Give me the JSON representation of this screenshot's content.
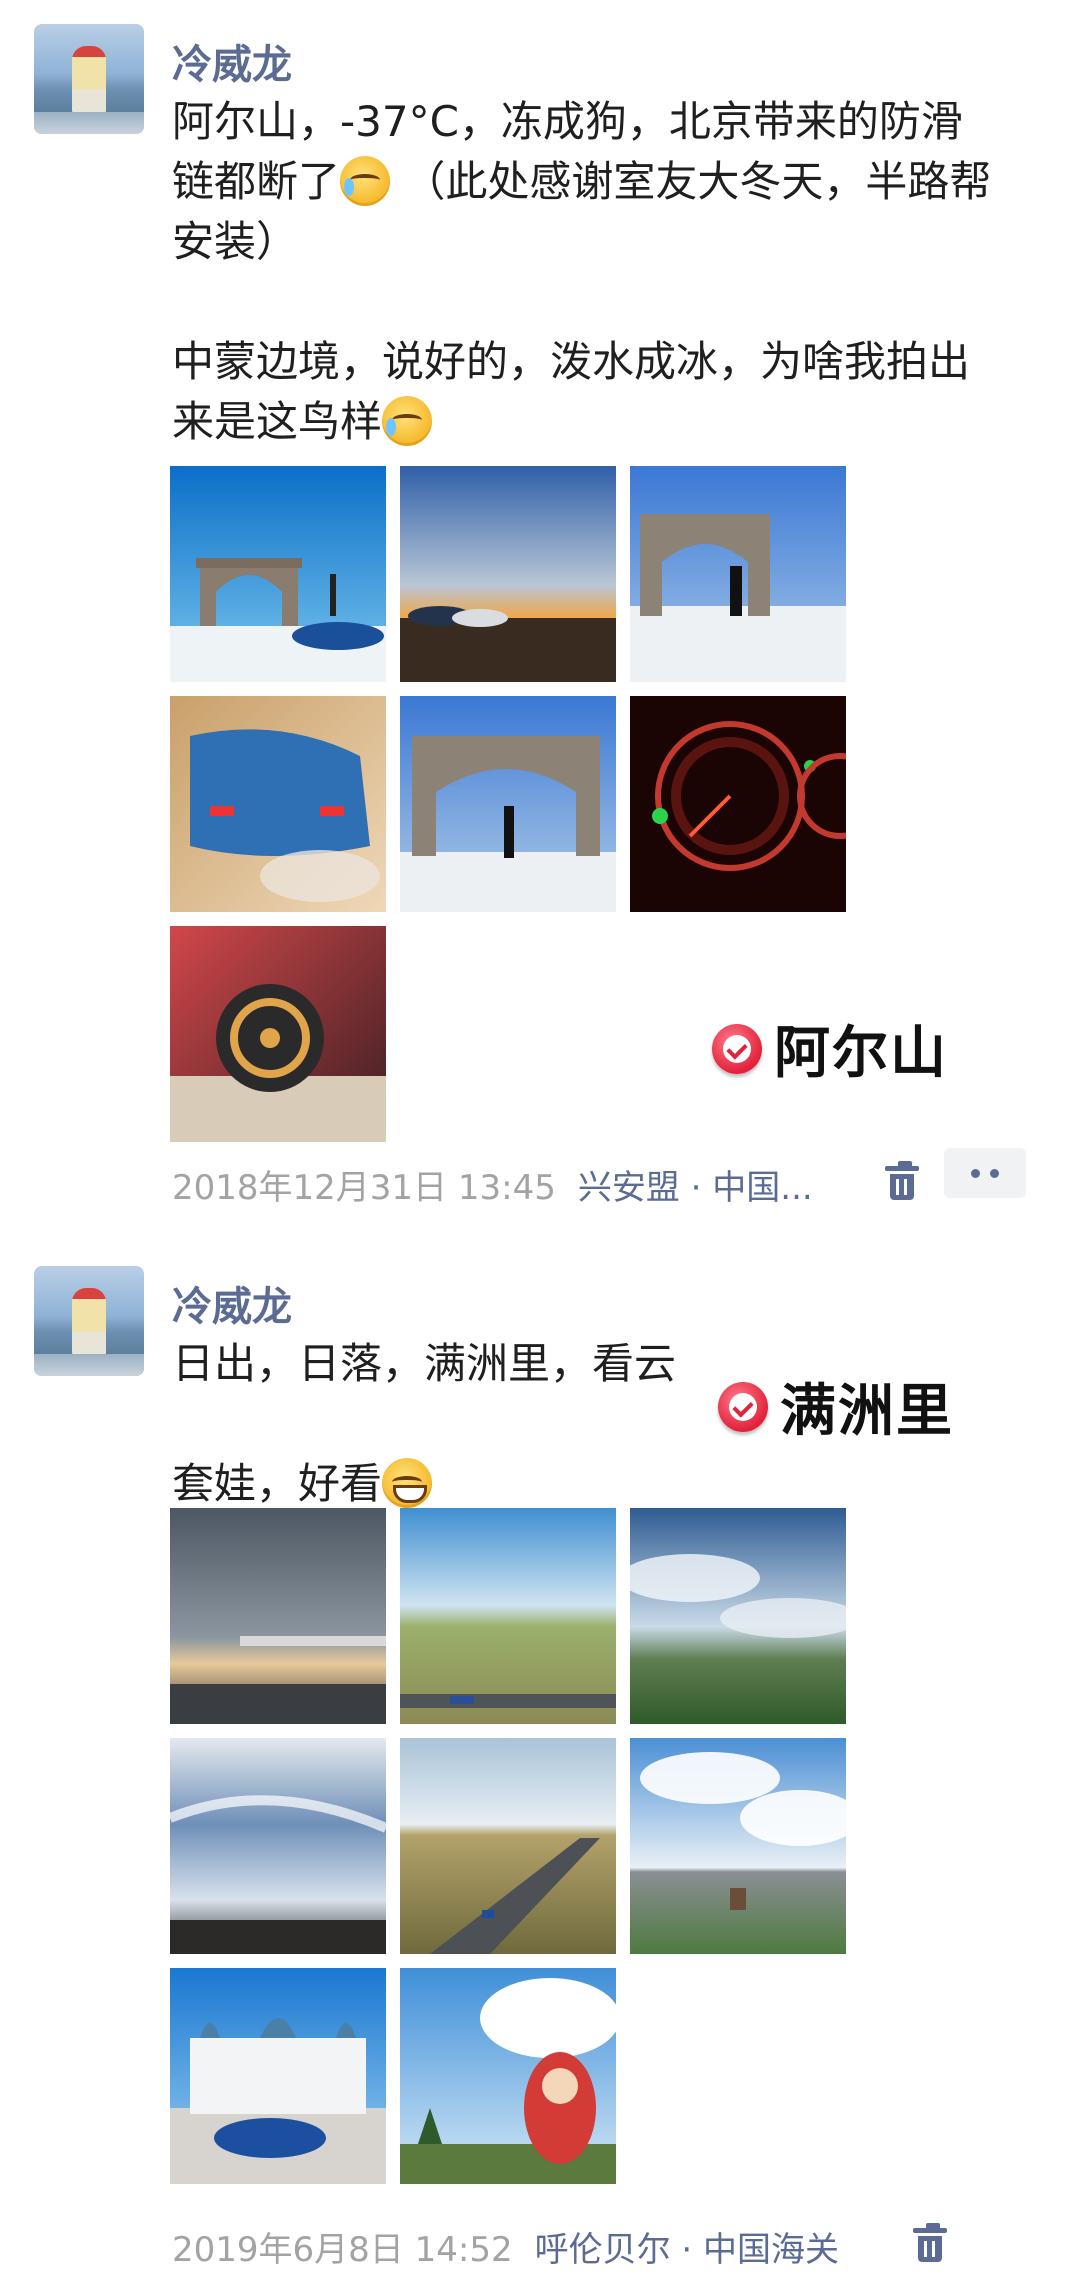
{
  "posts": [
    {
      "author": "冷威龙",
      "text_line1": "阿尔山，-37°C，冻成狗，北京带来的防滑",
      "text_line2a": "链都断了",
      "text_line2b": "（此处感谢室友大冬天，半路帮",
      "text_line3": "安装）",
      "text_line4": "中蒙边境，说好的，泼水成冰，为啥我拍出",
      "text_line5": "来是这鸟样",
      "emoji_icon": "crying-laughing-face-icon",
      "overlay_location": "阿尔山",
      "timestamp": "2018年12月31日 13:45",
      "place": "兴安盟 · 中国...",
      "photos": [
        {
          "desc": "border-arch-blue-sky"
        },
        {
          "desc": "sunset-cars"
        },
        {
          "desc": "arch-snow-pose"
        },
        {
          "desc": "blue-car-rear-smoke"
        },
        {
          "desc": "arch-snow-arms-up"
        },
        {
          "desc": "dashboard-gauges"
        },
        {
          "desc": "wheel-snow-chain"
        }
      ]
    },
    {
      "author": "冷威龙",
      "text_line1": "日出，日落，满洲里，看云",
      "text_line2": "套娃，好看",
      "emoji_icon": "grinning-face-icon",
      "overlay_location": "满洲里",
      "timestamp": "2019年6月8日 14:52",
      "place": "呼伦贝尔 · 中国海关",
      "photos": [
        {
          "desc": "cloudy-toll-station"
        },
        {
          "desc": "grassland-road"
        },
        {
          "desc": "clouds-hills"
        },
        {
          "desc": "sky-streaks"
        },
        {
          "desc": "highway-grassland"
        },
        {
          "desc": "town-aerial-clouds"
        },
        {
          "desc": "palace-blue-car"
        },
        {
          "desc": "matryoshka-doll"
        }
      ]
    }
  ],
  "colors": {
    "name": "#5b6b93",
    "meta": "#a3a3a3",
    "pin": "#e2223a"
  }
}
